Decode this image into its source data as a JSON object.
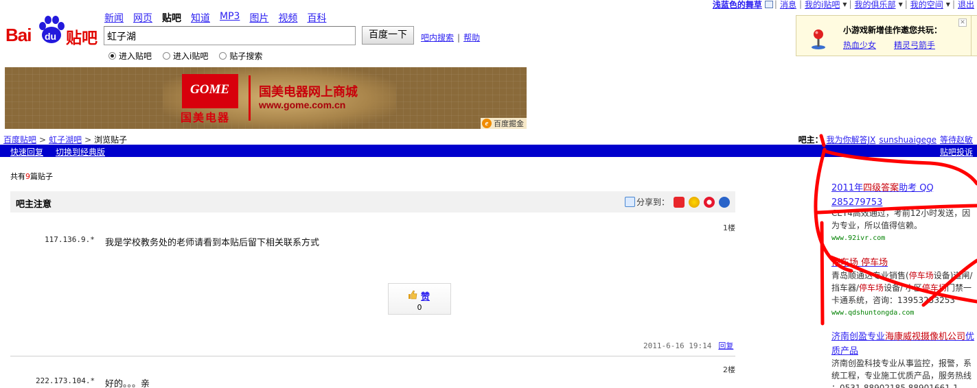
{
  "userbar": {
    "username": "浅蓝色的舞草",
    "items": [
      "消息",
      "我的i贴吧",
      "我的俱乐部",
      "我的空间",
      "退出"
    ]
  },
  "logo": {
    "bai": "Bai",
    "du": "du",
    "tieba": "贴吧"
  },
  "nav": [
    "新闻",
    "网页",
    "贴吧",
    "知道",
    "MP3",
    "图片",
    "视频",
    "百科"
  ],
  "search": {
    "value": "虹子湖",
    "button": "百度一下",
    "inbar": "吧内搜索",
    "help": "帮助"
  },
  "radios": [
    {
      "label": "进入贴吧",
      "checked": true
    },
    {
      "label": "进入i贴吧",
      "checked": false
    },
    {
      "label": "贴子搜索",
      "checked": false
    }
  ],
  "promo": {
    "title": "小游戏新增佳作邀您共玩：",
    "games": [
      "热血少女",
      "精灵弓箭手"
    ]
  },
  "banner": {
    "logo_en": "GOME",
    "logo_cn": "国美电器",
    "headline": "国美电器网上商城",
    "url": "www.gome.com.cn",
    "badge": "百度掘金",
    "badge_icon": "e"
  },
  "breadcrumb": {
    "items": [
      "百度贴吧",
      "虹子湖吧"
    ],
    "current": "浏览贴子"
  },
  "owners": {
    "label": "吧主：",
    "names": [
      "我为你解答JX",
      "sunshuaigege",
      "等待赵敏"
    ]
  },
  "bluebar": {
    "quick_reply": "快速回复",
    "classic": "切换到经典版",
    "report": "贴吧投诉"
  },
  "post_count": {
    "prefix": "共有",
    "n": "9",
    "suffix": "篇贴子"
  },
  "thread": {
    "title": "吧主注意",
    "share_label": "分享到："
  },
  "posts": [
    {
      "floor": "1楼",
      "ip": "117.136.9.*",
      "content": "我是学校教务处的老师请看到本贴后留下相关联系方式"
    },
    {
      "floor": "2楼",
      "ip": "222.173.104.*",
      "content": "好的。。。亲"
    }
  ],
  "like": {
    "label": "赞",
    "count": "0"
  },
  "post_meta": {
    "time": "2011-6-16 19:14",
    "reply": "回复"
  },
  "ads": [
    {
      "title_a": "2011年",
      "title_hl": "四级答案",
      "title_b": "助考 QQ 285279753",
      "desc": "CET4高效通过，考前12小时发送，因为专业，所以值得信赖。",
      "url": "www.92ivr.com"
    },
    {
      "title_hl": "停车场 停车场",
      "desc_a": "青岛顺通达专业销售(",
      "desc_hl1": "停车场",
      "desc_b": "设备)道闸/挡车器/",
      "desc_hl2": "停车场",
      "desc_c": "设备/ 小区",
      "desc_hl3": "停车场",
      "desc_d": "门禁一卡通系统，咨询：13953253253",
      "url": "www.qdshuntongda.com"
    },
    {
      "title_a": "济南创盈专业",
      "title_hl": "海康威视摄像机公司",
      "title_b": "优质产品",
      "desc": "济南创盈科技专业从事监控，报警，系统工程，专业施工优质产品，服务热线 ：0531-88902185 88901661-1"
    }
  ],
  "colors": {
    "blue_bar": "#0000cc",
    "link": "#2a1ef0",
    "red": "#e10601",
    "annotation": "#ff0000"
  }
}
